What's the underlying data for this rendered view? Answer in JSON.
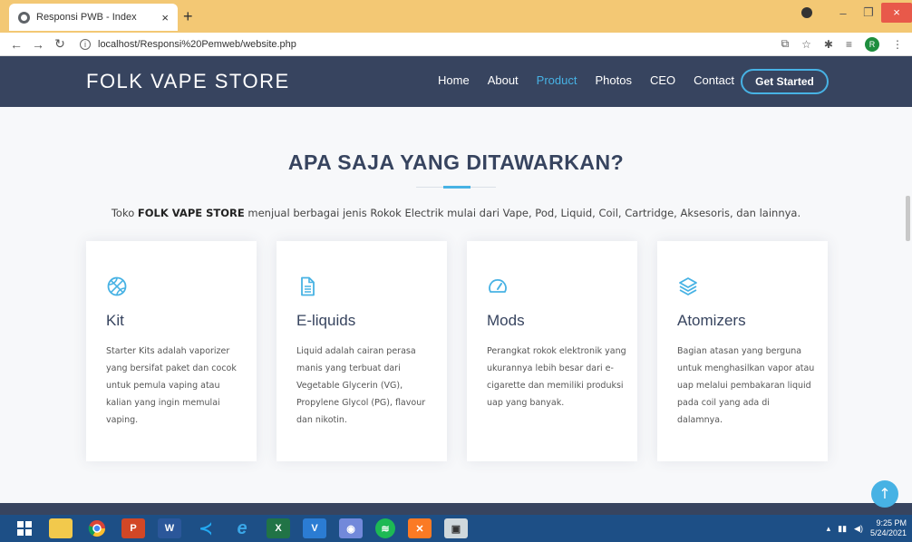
{
  "browser": {
    "tab_title": "Responsi PWB - Index",
    "tab_close": "×",
    "new_tab": "+",
    "url": "localhost/Responsi%20Pemweb/website.php",
    "profile_initial": "R",
    "window_minimize": "–",
    "window_restore": "❐",
    "window_close": "×"
  },
  "site": {
    "brand": "FOLK VAPE STORE",
    "menu": [
      "Home",
      "About",
      "Product",
      "Photos",
      "CEO",
      "Contact"
    ],
    "active_menu": "Product",
    "cta": "Get Started"
  },
  "section": {
    "title": "APA SAJA YANG DITAWARKAN?",
    "desc_prefix": "Toko ",
    "desc_bold": "FOLK VAPE STORE",
    "desc_suffix": " menjual berbagai jenis Rokok Electrik mulai dari Vape, Pod, Liquid, Coil, Cartridge, Aksesoris, dan lainnya."
  },
  "cards": [
    {
      "icon": "basketball-icon",
      "title": "Kit",
      "text": "Starter Kits adalah vaporizer yang bersifat paket dan cocok untuk pemula vaping atau kalian yang ingin memulai vaping."
    },
    {
      "icon": "file-icon",
      "title": "E-liquids",
      "text": "Liquid adalah cairan perasa manis yang terbuat dari Vegetable Glycerin (VG), Propylene Glycol (PG), flavour dan nikotin."
    },
    {
      "icon": "speedometer-icon",
      "title": "Mods",
      "text": "Perangkat rokok elektronik yang ukurannya lebih besar dari e-cigarette dan memiliki produksi uap yang banyak."
    },
    {
      "icon": "layers-icon",
      "title": "Atomizers",
      "text": "Bagian atasan yang berguna untuk menghasilkan vapor atau uap melalui pembakaran liquid pada coil yang ada di dalamnya."
    }
  ],
  "taskbar": {
    "time": "9:25 PM",
    "date": "5/24/2021"
  },
  "colors": {
    "navy": "#37445f",
    "accent": "#47b2e4",
    "tab_strip": "#f3c874",
    "taskbar": "#1d4f86"
  }
}
